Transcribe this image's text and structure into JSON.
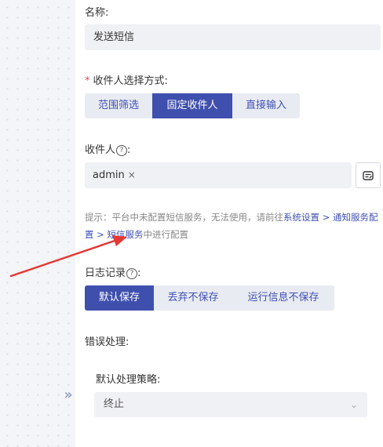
{
  "nav": {
    "collapse_icon": "»"
  },
  "form": {
    "name": {
      "label": "名称:",
      "value": "发送短信"
    },
    "recipient_mode": {
      "required_mark": "*",
      "label": "收件人选择方式:",
      "options": [
        "范围筛选",
        "固定收件人",
        "直接输入"
      ],
      "selected": "固定收件人"
    },
    "recipients": {
      "label": "收件人",
      "help": "?",
      "label_suffix": ":",
      "tags": [
        {
          "text": "admin",
          "remove": "×"
        }
      ]
    },
    "hint": {
      "prefix": "提示：平台中未配置短信服务，无法使用，请前往",
      "link1": "系统设置",
      "sep1": " > ",
      "link2": "通知服务配置",
      "sep2": " > ",
      "link3": "短信服务",
      "suffix": "中进行配置"
    },
    "log": {
      "label": "日志记录",
      "help": "?",
      "label_suffix": ":",
      "options": [
        "默认保存",
        "丢弃不保存",
        "运行信息不保存"
      ],
      "selected": "默认保存"
    },
    "error_handling": {
      "label": "错误处理:",
      "strategy_label": "默认处理策略:",
      "strategy_value": "终止"
    }
  },
  "colors": {
    "accent": "#3f4fae",
    "link": "#3f51b5",
    "annotation_arrow": "#e53935"
  }
}
